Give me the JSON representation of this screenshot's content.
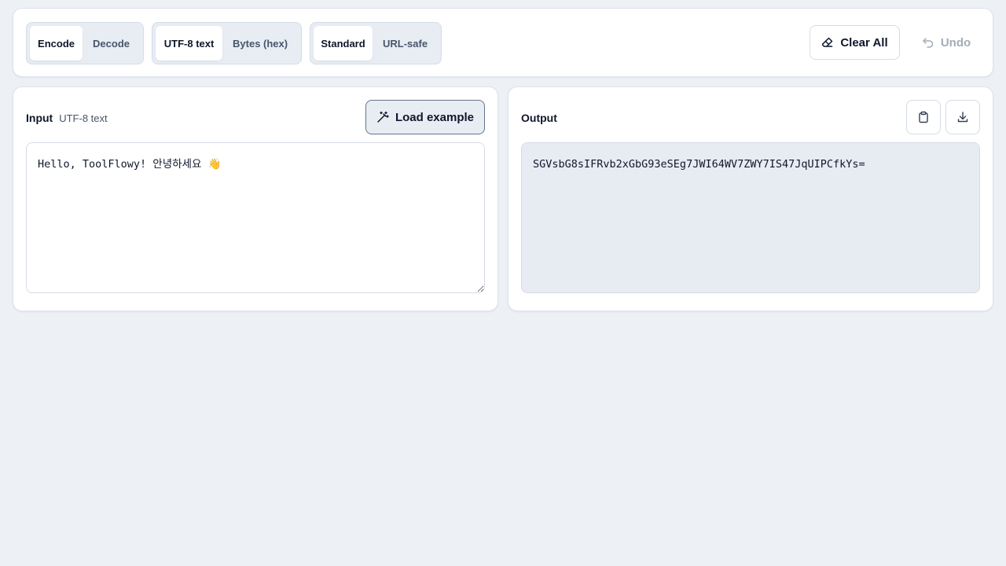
{
  "toolbar": {
    "mode": {
      "options": [
        "Encode",
        "Decode"
      ],
      "active": "Encode"
    },
    "input_format": {
      "options": [
        "UTF-8 text",
        "Bytes (hex)"
      ],
      "active": "UTF-8 text"
    },
    "alphabet": {
      "options": [
        "Standard",
        "URL-safe"
      ],
      "active": "Standard"
    },
    "clear_label": "Clear All",
    "clear_icon": "eraser-icon",
    "undo_label": "Undo",
    "undo_icon": "undo-icon",
    "undo_enabled": false
  },
  "input_panel": {
    "title": "Input",
    "subtitle": "UTF-8 text",
    "load_example_label": "Load example",
    "load_example_icon": "magic-wand-icon",
    "value": "Hello, ToolFlowy! 안녕하세요 👋"
  },
  "output_panel": {
    "title": "Output",
    "copy_icon": "clipboard-icon",
    "download_icon": "download-icon",
    "value": "SGVsbG8sIFRvb2xGbG93eSEg7JWI64WV7ZWY7IS47JqUIPCfkYs="
  },
  "colors": {
    "background": "#edf1f6",
    "panel": "#ffffff",
    "segment_bg": "#e8edf4",
    "output_bg": "#e7ecf3",
    "text": "#0f172a",
    "muted": "#475569",
    "disabled": "#a3acb9"
  }
}
